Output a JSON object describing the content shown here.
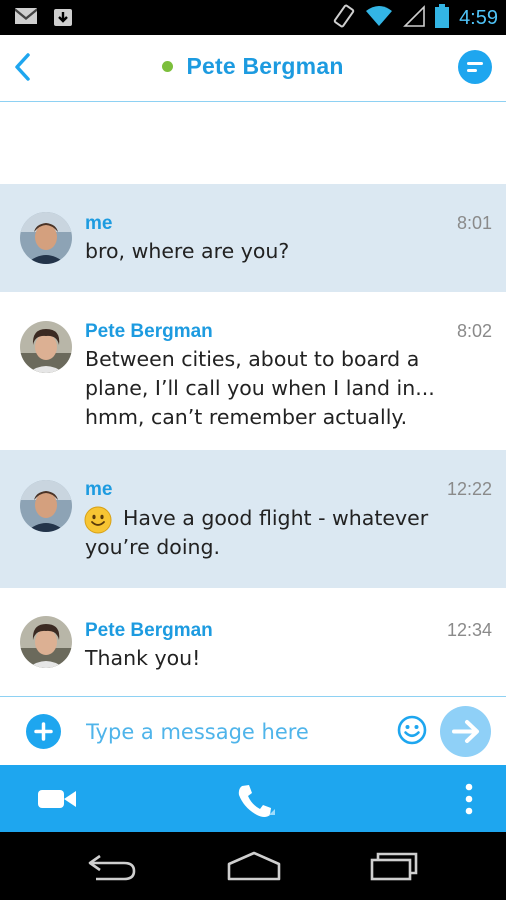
{
  "status_bar": {
    "time": "4:59",
    "icons": [
      "gmail-icon",
      "download-icon",
      "vibrate-icon",
      "wifi-icon",
      "signal-icon",
      "battery-icon"
    ]
  },
  "header": {
    "title": "Pete Bergman",
    "presence": "online",
    "presence_color": "#7cbf3c",
    "accent_color": "#1d9be0"
  },
  "messages": [
    {
      "sender": "me",
      "time": "8:01",
      "text": "bro, where are you?",
      "is_me": true,
      "emoji": false
    },
    {
      "sender": "Pete Bergman",
      "time": "8:02",
      "text": "Between cities, about to board a plane, I’ll call you when I land in... hmm, can’t remember actually.",
      "is_me": false,
      "emoji": false
    },
    {
      "sender": "me",
      "time": "12:22",
      "text": "Have a good flight - whatever you’re doing.",
      "is_me": true,
      "emoji": true
    },
    {
      "sender": "Pete Bergman",
      "time": "12:34",
      "text": "Thank you!",
      "is_me": false,
      "emoji": false
    }
  ],
  "composer": {
    "placeholder": "Type a message here"
  },
  "action_bar": {
    "icons": [
      "video-call-icon",
      "phone-icon",
      "more-vert-icon"
    ]
  },
  "nav_bar": {
    "icons": [
      "back-nav-icon",
      "home-nav-icon",
      "recents-nav-icon"
    ]
  }
}
